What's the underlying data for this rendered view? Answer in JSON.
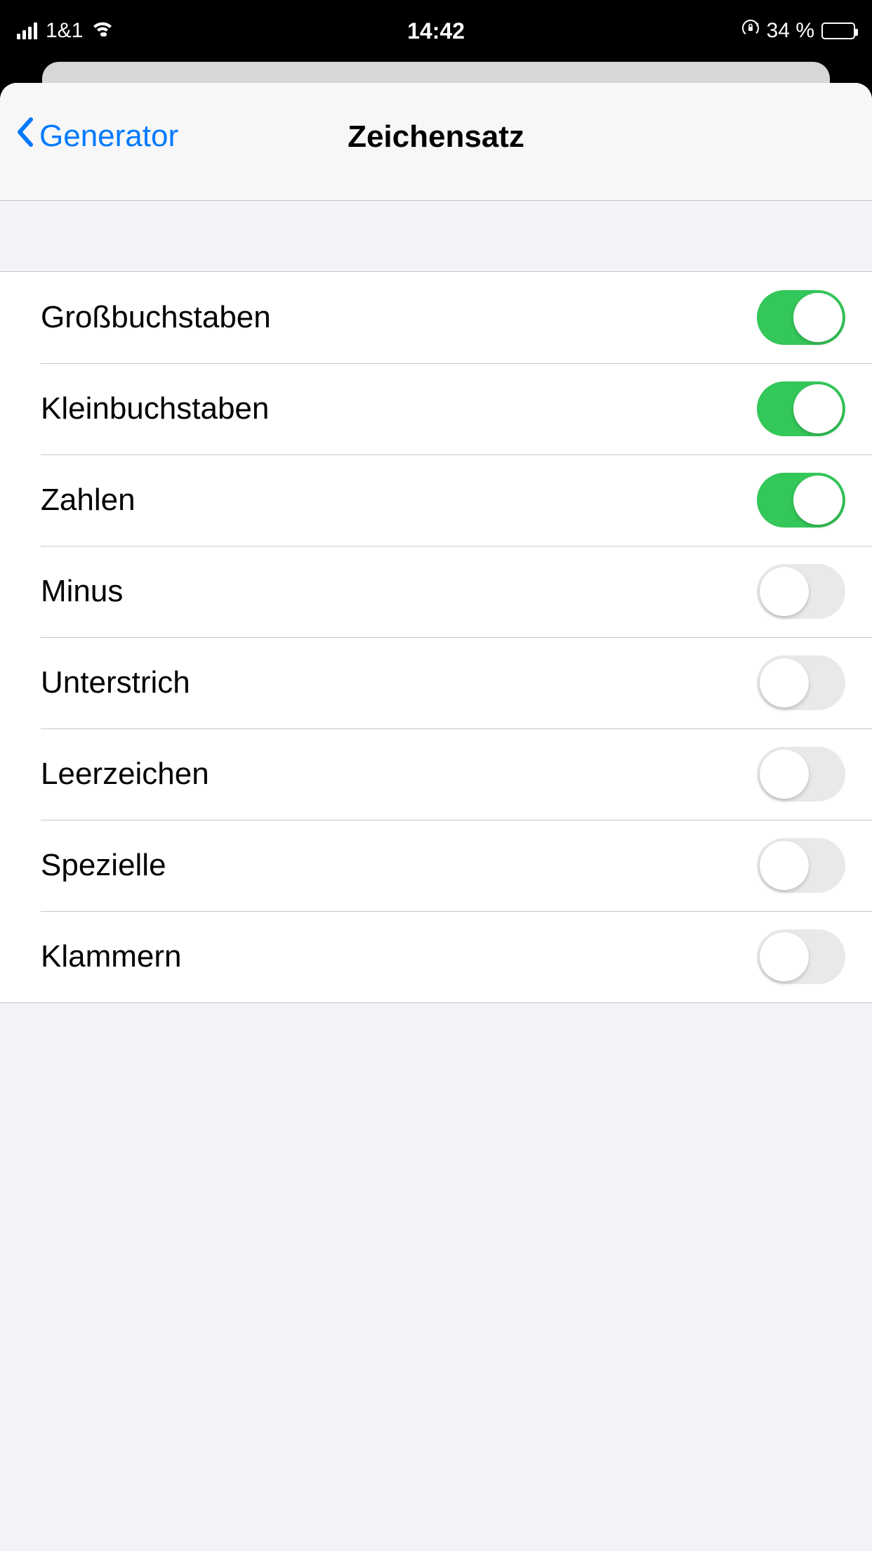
{
  "status_bar": {
    "carrier": "1&1",
    "time": "14:42",
    "battery_text": "34 %",
    "battery_pct": 34
  },
  "navbar": {
    "back_label": "Generator",
    "title": "Zeichensatz"
  },
  "settings": [
    {
      "key": "uppercase",
      "label": "Großbuchstaben",
      "on": true
    },
    {
      "key": "lowercase",
      "label": "Kleinbuchstaben",
      "on": true
    },
    {
      "key": "digits",
      "label": "Zahlen",
      "on": true
    },
    {
      "key": "minus",
      "label": "Minus",
      "on": false
    },
    {
      "key": "underscore",
      "label": "Unterstrich",
      "on": false
    },
    {
      "key": "space",
      "label": "Leerzeichen",
      "on": false
    },
    {
      "key": "special",
      "label": "Spezielle",
      "on": false
    },
    {
      "key": "brackets",
      "label": "Klammern",
      "on": false
    }
  ]
}
